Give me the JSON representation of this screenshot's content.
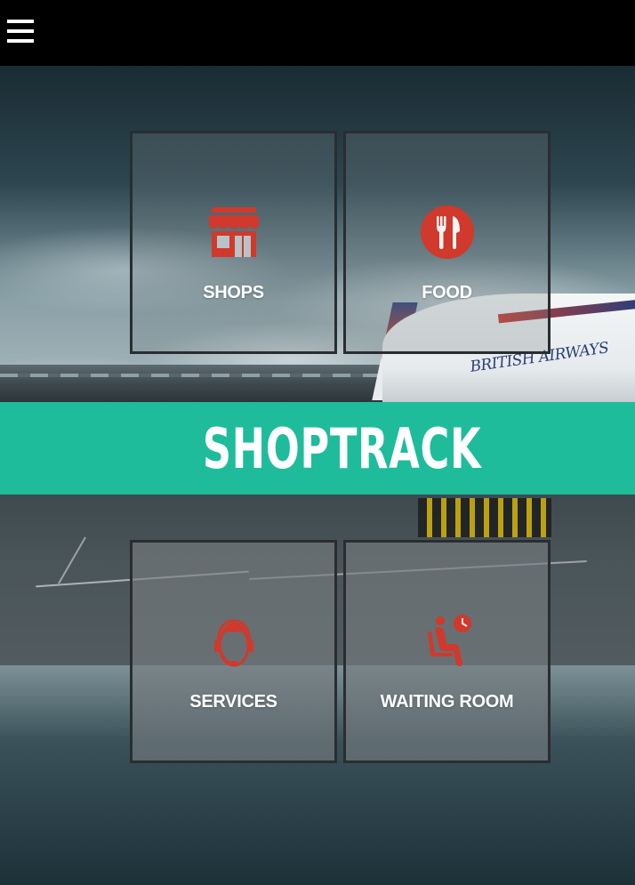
{
  "header": {
    "menu_icon": "hamburger-menu-icon",
    "menu_label": "☰"
  },
  "banner": {
    "title": "SHOPTRACK",
    "color": "#1fbc9c"
  },
  "tiles": [
    {
      "label": "SHOPS",
      "icon": "shop-icon"
    },
    {
      "label": "FOOD",
      "icon": "fork-knife-icon"
    },
    {
      "label": "SERVICES",
      "icon": "customer-service-icon"
    },
    {
      "label": "WAITING ROOM",
      "icon": "waiting-room-icon"
    }
  ],
  "background": {
    "plane_text": "BRITISH AIRWAYS"
  },
  "colors": {
    "accent": "#1fbc9c",
    "icon_red": "#d0392b",
    "header_bg": "#000000"
  }
}
